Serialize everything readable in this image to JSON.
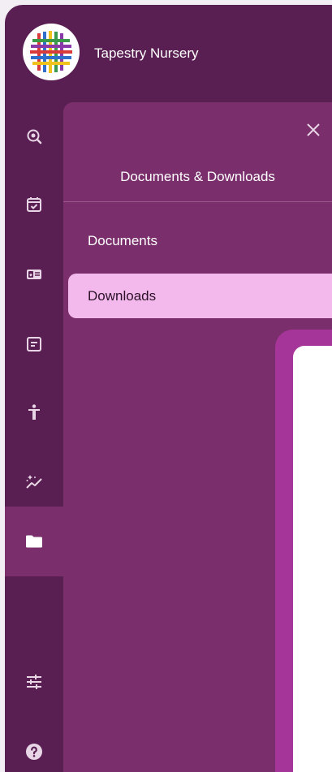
{
  "app": {
    "title": "Tapestry Nursery",
    "brand_color": "#5a1f52",
    "panel_color": "#7a2f6c",
    "selected_color": "#f3b9ec"
  },
  "rail": {
    "items": [
      {
        "icon": "eye-search-icon"
      },
      {
        "icon": "calendar-check-icon"
      },
      {
        "icon": "id-card-icon"
      },
      {
        "icon": "document-icon"
      },
      {
        "icon": "accessibility-icon"
      },
      {
        "icon": "sparkle-chart-icon"
      },
      {
        "icon": "folder-icon",
        "active": true
      },
      {
        "icon": "sliders-icon"
      },
      {
        "icon": "help-icon"
      }
    ]
  },
  "panel": {
    "title": "Documents & Downloads",
    "items": [
      {
        "label": "Documents",
        "selected": false
      },
      {
        "label": "Downloads",
        "selected": true
      }
    ]
  }
}
